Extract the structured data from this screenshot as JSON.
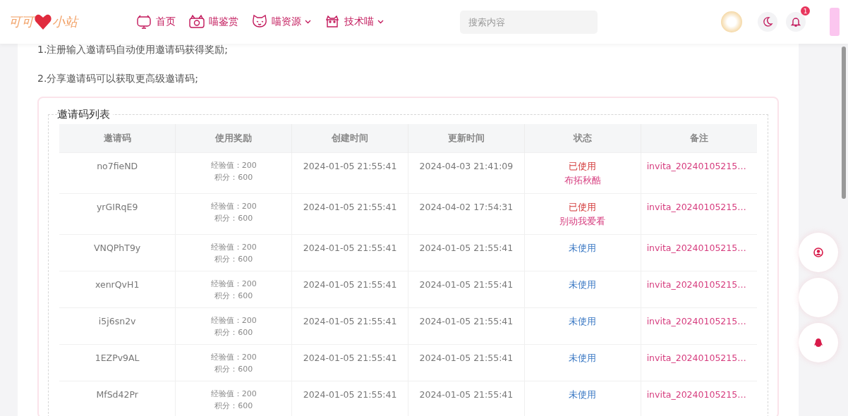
{
  "header": {
    "logo": {
      "left": "可可",
      "right": "小站"
    },
    "nav": [
      {
        "label": "首页",
        "dropdown": false
      },
      {
        "label": "喵鉴赏",
        "dropdown": false
      },
      {
        "label": "喵资源",
        "dropdown": true
      },
      {
        "label": "技术喵",
        "dropdown": true
      }
    ],
    "search": {
      "placeholder": "搜索内容"
    },
    "notifications": {
      "badge": "1"
    }
  },
  "intro": [
    "1.注册输入邀请码自动使用邀请码获得奖励;",
    "2.分享邀请码可以获取更高级邀请码;"
  ],
  "invite_list": {
    "title": "邀请码列表",
    "table": {
      "columns": [
        "邀请码",
        "使用奖励",
        "创建时间",
        "更新时间",
        "状态",
        "备注"
      ],
      "rows": [
        {
          "code": "no7fieND",
          "reward": [
            "经验值：200",
            "积分：600"
          ],
          "created": "2024-01-05 21:55:41",
          "updated": "2024-04-03 21:41:09",
          "status": {
            "kind": "used",
            "label": "已使用",
            "user": "布拓秋酷"
          },
          "remark": "invita_20240105215…"
        },
        {
          "code": "yrGIRqE9",
          "reward": [
            "经验值：200",
            "积分：600"
          ],
          "created": "2024-01-05 21:55:41",
          "updated": "2024-04-02 17:54:31",
          "status": {
            "kind": "used",
            "label": "已使用",
            "user": "别动我爱看"
          },
          "remark": "invita_20240105215…"
        },
        {
          "code": "VNQPhT9y",
          "reward": [
            "经验值：200",
            "积分：600"
          ],
          "created": "2024-01-05 21:55:41",
          "updated": "2024-01-05 21:55:41",
          "status": {
            "kind": "unused",
            "label": "未使用"
          },
          "remark": "invita_20240105215…"
        },
        {
          "code": "xenrQvH1",
          "reward": [
            "经验值：200",
            "积分：600"
          ],
          "created": "2024-01-05 21:55:41",
          "updated": "2024-01-05 21:55:41",
          "status": {
            "kind": "unused",
            "label": "未使用"
          },
          "remark": "invita_20240105215…"
        },
        {
          "code": "i5j6sn2v",
          "reward": [
            "经验值：200",
            "积分：600"
          ],
          "created": "2024-01-05 21:55:41",
          "updated": "2024-01-05 21:55:41",
          "status": {
            "kind": "unused",
            "label": "未使用"
          },
          "remark": "invita_20240105215…"
        },
        {
          "code": "1EZPv9AL",
          "reward": [
            "经验值：200",
            "积分：600"
          ],
          "created": "2024-01-05 21:55:41",
          "updated": "2024-01-05 21:55:41",
          "status": {
            "kind": "unused",
            "label": "未使用"
          },
          "remark": "invita_20240105215…"
        },
        {
          "code": "MfSd42Pr",
          "reward": [
            "经验值：200",
            "积分：600"
          ],
          "created": "2024-01-05 21:55:41",
          "updated": "2024-01-05 21:55:41",
          "status": {
            "kind": "unused",
            "label": "未使用"
          },
          "remark": "invita_20240105215…"
        }
      ]
    }
  }
}
